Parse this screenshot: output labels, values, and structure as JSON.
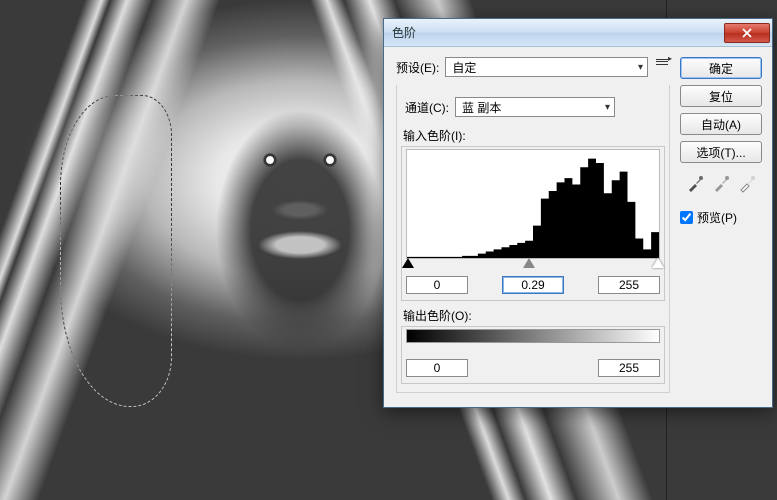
{
  "dialog": {
    "title": "色阶",
    "preset_label": "预设(E):",
    "preset_value": "自定",
    "channel_label": "通道(C):",
    "channel_value": "蓝 副本",
    "input_levels_label": "输入色阶(I):",
    "output_levels_label": "输出色阶(O):",
    "input": {
      "shadow": "0",
      "midtone": "0.29",
      "highlight": "255"
    },
    "output": {
      "shadow": "0",
      "highlight": "255"
    },
    "buttons": {
      "ok": "确定",
      "cancel": "复位",
      "auto": "自动(A)",
      "options": "选项(T)...",
      "preview": "预览(P)"
    }
  },
  "chart_data": {
    "type": "area",
    "title": "",
    "xlabel": "",
    "ylabel": "",
    "xlim": [
      0,
      255
    ],
    "ylim": [
      0,
      100
    ],
    "series": [
      {
        "name": "histogram",
        "values_by_bucket32": [
          1,
          1,
          1,
          1,
          1,
          1,
          1,
          2,
          2,
          4,
          6,
          8,
          10,
          12,
          14,
          16,
          30,
          55,
          62,
          70,
          74,
          68,
          84,
          92,
          88,
          60,
          72,
          80,
          52,
          18,
          8,
          24
        ]
      }
    ]
  }
}
